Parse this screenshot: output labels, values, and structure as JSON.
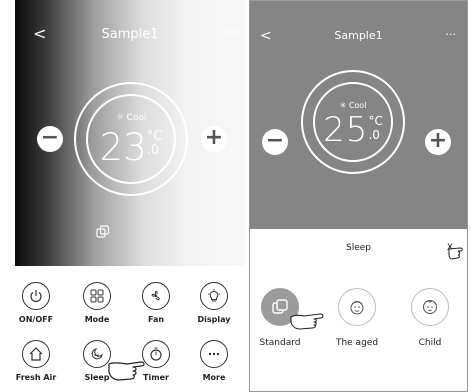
{
  "left_screen": {
    "back": "<",
    "title": "Sample1",
    "menu": "ooo",
    "mode": "Cool",
    "temp_value": "23",
    "temp_unit": "°C",
    "temp_decimal": ".0",
    "minus": "−",
    "plus": "+",
    "buttons": [
      {
        "label": "ON/OFF",
        "icon": "power-icon"
      },
      {
        "label": "Mode",
        "icon": "mode-grid-icon"
      },
      {
        "label": "Fan",
        "icon": "fan-icon"
      },
      {
        "label": "Display",
        "icon": "bulb-icon"
      },
      {
        "label": "Fresh Air",
        "icon": "house-icon"
      },
      {
        "label": "Sleep",
        "icon": "sleep-face-icon"
      },
      {
        "label": "Timer",
        "icon": "timer-icon"
      },
      {
        "label": "More",
        "icon": "more-dots-icon"
      }
    ]
  },
  "right_screen": {
    "back": "<",
    "title": "Sample1",
    "menu": "...",
    "mode": "Cool",
    "temp_value": "25",
    "temp_unit": "°C",
    "temp_decimal": ".0",
    "minus": "−",
    "plus": "+",
    "sleep_panel": {
      "title": "Sleep",
      "close": "X",
      "options": [
        {
          "label": "Standard",
          "icon": "standard-sleep-icon",
          "selected": true
        },
        {
          "label": "The aged",
          "icon": "aged-face-icon",
          "selected": false
        },
        {
          "label": "Child",
          "icon": "child-face-icon",
          "selected": false
        }
      ]
    }
  }
}
